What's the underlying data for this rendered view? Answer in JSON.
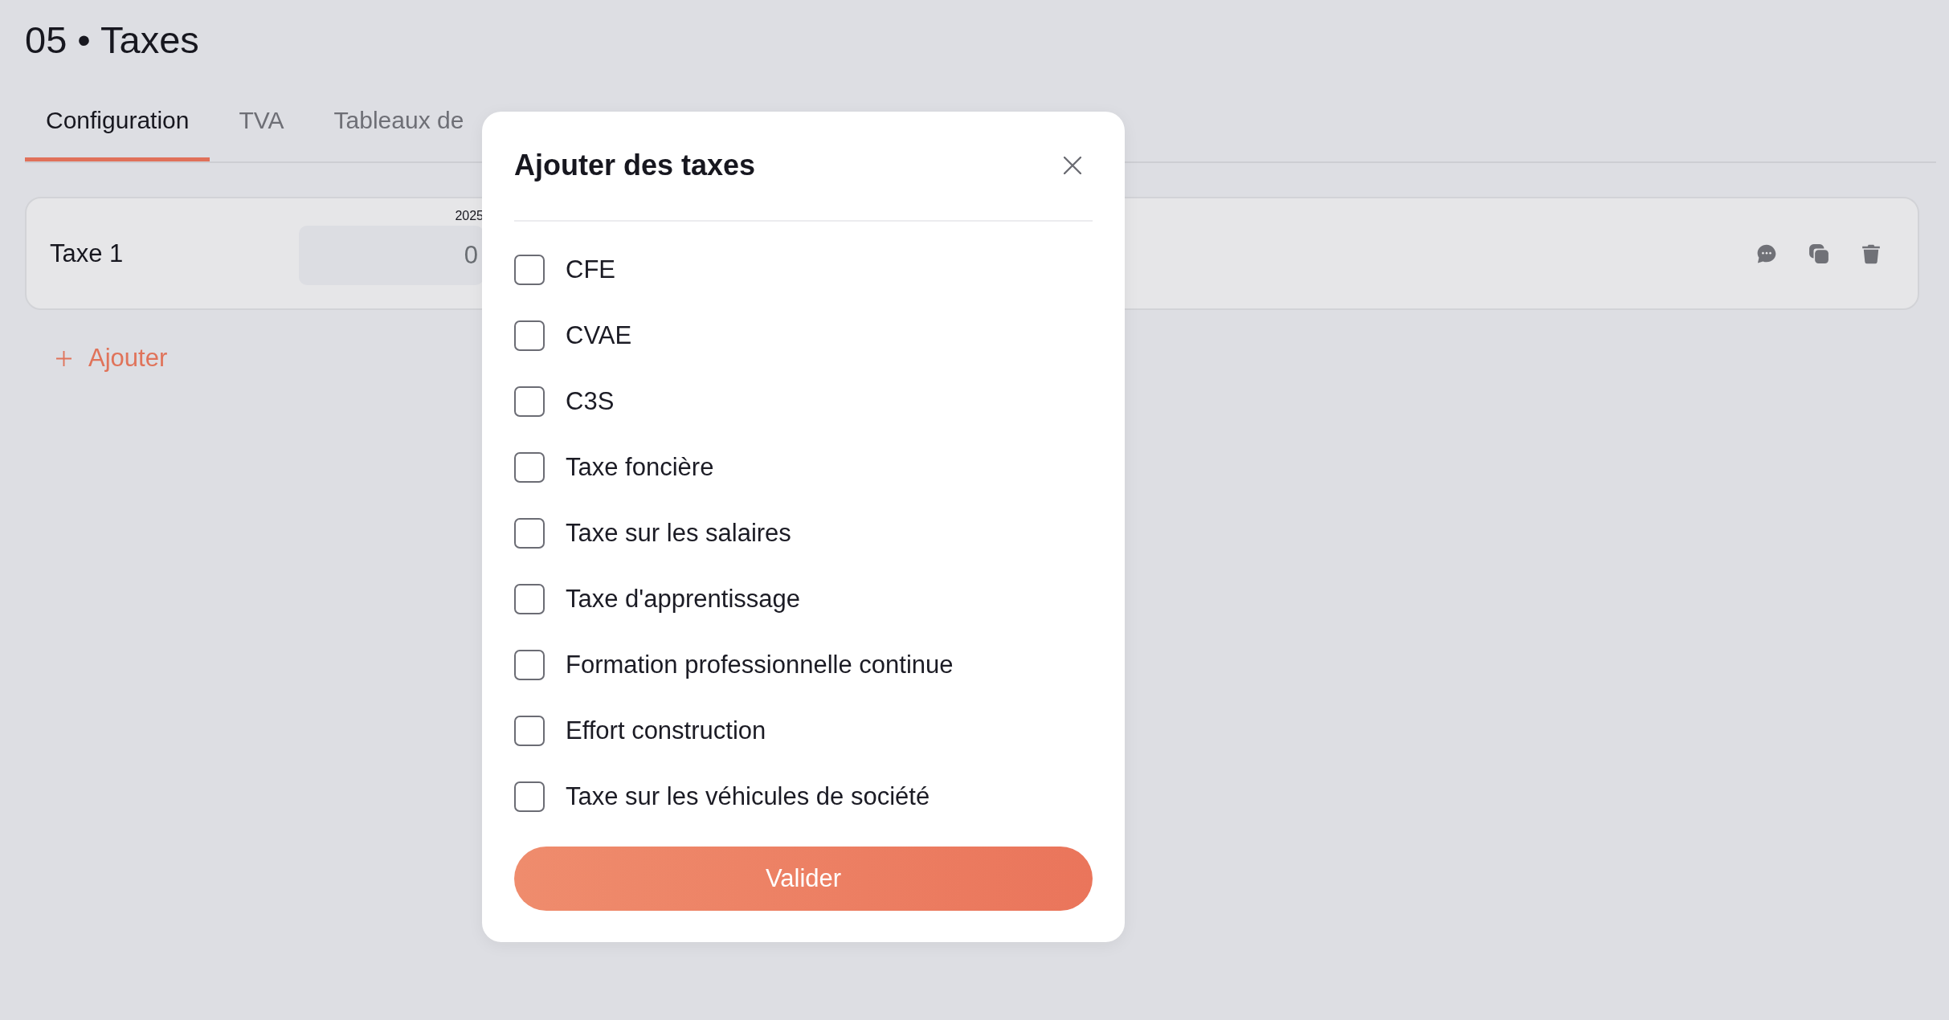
{
  "page": {
    "title": "05 • Taxes"
  },
  "tabs": [
    {
      "label": "Configuration",
      "selected": true
    },
    {
      "label": "TVA",
      "selected": false
    },
    {
      "label": "Tableaux de",
      "selected": false
    }
  ],
  "tax_rows": [
    {
      "name": "Taxe 1",
      "year": "2025",
      "value": "0"
    }
  ],
  "add_link": {
    "label": "Ajouter"
  },
  "modal": {
    "title": "Ajouter des taxes",
    "options": [
      {
        "label": "CFE",
        "checked": false
      },
      {
        "label": "CVAE",
        "checked": false
      },
      {
        "label": "C3S",
        "checked": false
      },
      {
        "label": "Taxe foncière",
        "checked": false
      },
      {
        "label": "Taxe sur les salaires",
        "checked": false
      },
      {
        "label": "Taxe d'apprentissage",
        "checked": false
      },
      {
        "label": "Formation professionnelle continue",
        "checked": false
      },
      {
        "label": "Effort construction",
        "checked": false
      },
      {
        "label": "Taxe sur les véhicules de société",
        "checked": false
      }
    ],
    "submit": "Valider"
  }
}
